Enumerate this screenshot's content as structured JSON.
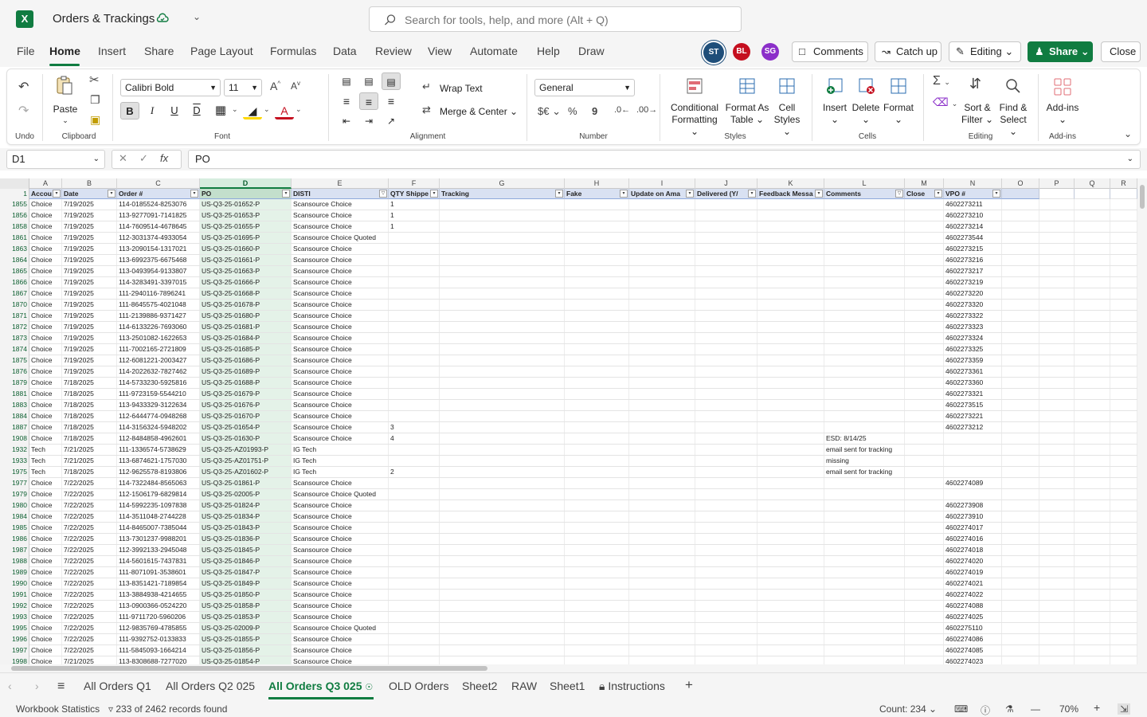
{
  "app": {
    "title": "Orders & Trackings",
    "logo": "X",
    "search_placeholder": "Search for tools, help, and more (Alt + Q)"
  },
  "menu": {
    "tabs": [
      "File",
      "Home",
      "Insert",
      "Share",
      "Page Layout",
      "Formulas",
      "Data",
      "Review",
      "View",
      "Automate",
      "Help",
      "Draw"
    ],
    "active": "Home"
  },
  "collab": {
    "avatars": [
      {
        "initials": "ST",
        "color": "#1f4e79"
      },
      {
        "initials": "BL",
        "color": "#c50f1f"
      },
      {
        "initials": "SG",
        "color": "#8b2fc9"
      }
    ],
    "comments": "Comments",
    "catchup": "Catch up",
    "editing": "Editing",
    "share": "Share",
    "close": "Close"
  },
  "ribbon": {
    "undo_label": "Undo",
    "clipboard_label": "Clipboard",
    "paste": "Paste",
    "font_name": "Calibri Bold",
    "font_size": "11",
    "font_label": "Font",
    "wrap_text": "Wrap Text",
    "merge_center": "Merge & Center",
    "alignment_label": "Alignment",
    "number_format": "General",
    "number_label": "Number",
    "cond_format_1": "Conditional",
    "cond_format_2": "Formatting",
    "format_table_1": "Format As",
    "format_table_2": "Table",
    "cell_styles_1": "Cell",
    "cell_styles_2": "Styles",
    "styles_label": "Styles",
    "insert": "Insert",
    "delete": "Delete",
    "format": "Format",
    "cells_label": "Cells",
    "sort_1": "Sort &",
    "sort_2": "Filter",
    "find_1": "Find &",
    "find_2": "Select",
    "editing_label": "Editing",
    "addins": "Add-ins",
    "addins_label": "Add-ins"
  },
  "formula_bar": {
    "name_box": "D1",
    "content": "PO"
  },
  "columns": {
    "letters": [
      "A",
      "B",
      "C",
      "D",
      "E",
      "F",
      "G",
      "H",
      "I",
      "J",
      "K",
      "L",
      "M",
      "N",
      "O",
      "P",
      "Q",
      "R"
    ],
    "selected": "D"
  },
  "headers": [
    "Accou",
    "Date",
    "Order #",
    "PO",
    "DISTI",
    "QTY Shippe",
    "Tracking",
    "Fake",
    "Update on Ama",
    "Delivered (Y/",
    "Feedback Messa",
    "Comments",
    "Close",
    "VPO #"
  ],
  "rows": [
    [
      "1855",
      "Choice",
      "7/19/2025",
      "114-0185524-8253076",
      "US-Q3-25-01652-P",
      "Scansource Choice",
      "1",
      "",
      "",
      "",
      "",
      "",
      "",
      "",
      "4602273211"
    ],
    [
      "1856",
      "Choice",
      "7/19/2025",
      "113-9277091-7141825",
      "US-Q3-25-01653-P",
      "Scansource Choice",
      "1",
      "",
      "",
      "",
      "",
      "",
      "",
      "",
      "4602273210"
    ],
    [
      "1858",
      "Choice",
      "7/19/2025",
      "114-7609514-4678645",
      "US-Q3-25-01655-P",
      "Scansource Choice",
      "1",
      "",
      "",
      "",
      "",
      "",
      "",
      "",
      "4602273214"
    ],
    [
      "1861",
      "Choice",
      "7/19/2025",
      "112-3031374-4933054",
      "US-Q3-25-01695-P",
      "Scansource Choice Quoted",
      "",
      "",
      "",
      "",
      "",
      "",
      "",
      "",
      "4602273544"
    ],
    [
      "1863",
      "Choice",
      "7/19/2025",
      "113-2090154-1317021",
      "US-Q3-25-01660-P",
      "Scansource Choice",
      "",
      "",
      "",
      "",
      "",
      "",
      "",
      "",
      "4602273215"
    ],
    [
      "1864",
      "Choice",
      "7/19/2025",
      "113-6992375-6675468",
      "US-Q3-25-01661-P",
      "Scansource Choice",
      "",
      "",
      "",
      "",
      "",
      "",
      "",
      "",
      "4602273216"
    ],
    [
      "1865",
      "Choice",
      "7/19/2025",
      "113-0493954-9133807",
      "US-Q3-25-01663-P",
      "Scansource Choice",
      "",
      "",
      "",
      "",
      "",
      "",
      "",
      "",
      "4602273217"
    ],
    [
      "1866",
      "Choice",
      "7/19/2025",
      "114-3283491-3397015",
      "US-Q3-25-01666-P",
      "Scansource Choice",
      "",
      "",
      "",
      "",
      "",
      "",
      "",
      "",
      "4602273219"
    ],
    [
      "1867",
      "Choice",
      "7/19/2025",
      "111-2940116-7896241",
      "US-Q3-25-01668-P",
      "Scansource Choice",
      "",
      "",
      "",
      "",
      "",
      "",
      "",
      "",
      "4602273220"
    ],
    [
      "1870",
      "Choice",
      "7/19/2025",
      "111-8645575-4021048",
      "US-Q3-25-01678-P",
      "Scansource Choice",
      "",
      "",
      "",
      "",
      "",
      "",
      "",
      "",
      "4602273320"
    ],
    [
      "1871",
      "Choice",
      "7/19/2025",
      "111-2139886-9371427",
      "US-Q3-25-01680-P",
      "Scansource Choice",
      "",
      "",
      "",
      "",
      "",
      "",
      "",
      "",
      "4602273322"
    ],
    [
      "1872",
      "Choice",
      "7/19/2025",
      "114-6133226-7693060",
      "US-Q3-25-01681-P",
      "Scansource Choice",
      "",
      "",
      "",
      "",
      "",
      "",
      "",
      "",
      "4602273323"
    ],
    [
      "1873",
      "Choice",
      "7/19/2025",
      "113-2501082-1622653",
      "US-Q3-25-01684-P",
      "Scansource Choice",
      "",
      "",
      "",
      "",
      "",
      "",
      "",
      "",
      "4602273324"
    ],
    [
      "1874",
      "Choice",
      "7/19/2025",
      "111-7002165-2721809",
      "US-Q3-25-01685-P",
      "Scansource Choice",
      "",
      "",
      "",
      "",
      "",
      "",
      "",
      "",
      "4602273325"
    ],
    [
      "1875",
      "Choice",
      "7/19/2025",
      "112-6081221-2003427",
      "US-Q3-25-01686-P",
      "Scansource Choice",
      "",
      "",
      "",
      "",
      "",
      "",
      "",
      "",
      "4602273359"
    ],
    [
      "1876",
      "Choice",
      "7/19/2025",
      "114-2022632-7827462",
      "US-Q3-25-01689-P",
      "Scansource Choice",
      "",
      "",
      "",
      "",
      "",
      "",
      "",
      "",
      "4602273361"
    ],
    [
      "1879",
      "Choice",
      "7/18/2025",
      "114-5733230-5925816",
      "US-Q3-25-01688-P",
      "Scansource Choice",
      "",
      "",
      "",
      "",
      "",
      "",
      "",
      "",
      "4602273360"
    ],
    [
      "1881",
      "Choice",
      "7/18/2025",
      "111-9723159-5544210",
      "US-Q3-25-01679-P",
      "Scansource Choice",
      "",
      "",
      "",
      "",
      "",
      "",
      "",
      "",
      "4602273321"
    ],
    [
      "1883",
      "Choice",
      "7/18/2025",
      "113-9433329-3122634",
      "US-Q3-25-01676-P",
      "Scansource Choice",
      "",
      "",
      "",
      "",
      "",
      "",
      "",
      "",
      "4602273515"
    ],
    [
      "1884",
      "Choice",
      "7/18/2025",
      "112-6444774-0948268",
      "US-Q3-25-01670-P",
      "Scansource Choice",
      "",
      "",
      "",
      "",
      "",
      "",
      "",
      "",
      "4602273221"
    ],
    [
      "1887",
      "Choice",
      "7/18/2025",
      "114-3156324-5948202",
      "US-Q3-25-01654-P",
      "Scansource Choice",
      "3",
      "",
      "",
      "",
      "",
      "",
      "",
      "",
      "4602273212"
    ],
    [
      "1908",
      "Choice",
      "7/18/2025",
      "112-8484858-4962601",
      "US-Q3-25-01630-P",
      "Scansource Choice",
      "4",
      "",
      "",
      "",
      "",
      "",
      "ESD: 8/14/25",
      "",
      ""
    ],
    [
      "1932",
      "Tech",
      "7/21/2025",
      "111-1336574-5738629",
      "US-Q3-25-AZ01993-P",
      "IG Tech",
      "",
      "",
      "",
      "",
      "",
      "",
      "email sent for tracking",
      "",
      ""
    ],
    [
      "1933",
      "Tech",
      "7/21/2025",
      "113-6874621-1757030",
      "US-Q3-25-AZ01751-P",
      "IG Tech",
      "",
      "",
      "",
      "",
      "",
      "",
      "missing",
      "",
      ""
    ],
    [
      "1975",
      "Tech",
      "7/18/2025",
      "112-9625578-8193806",
      "US-Q3-25-AZ01602-P",
      "IG Tech",
      "2",
      "",
      "",
      "",
      "",
      "",
      "email sent for tracking",
      "",
      ""
    ],
    [
      "1977",
      "Choice",
      "7/22/2025",
      "114-7322484-8565063",
      "US-Q3-25-01861-P",
      "Scansource Choice",
      "",
      "",
      "",
      "",
      "",
      "",
      "",
      "",
      "4602274089"
    ],
    [
      "1979",
      "Choice",
      "7/22/2025",
      "112-1506179-6829814",
      "US-Q3-25-02005-P",
      "Scansource Choice Quoted",
      "",
      "",
      "",
      "",
      "",
      "",
      "",
      "",
      ""
    ],
    [
      "1980",
      "Choice",
      "7/22/2025",
      "114-5992235-1097838",
      "US-Q3-25-01824-P",
      "Scansource Choice",
      "",
      "",
      "",
      "",
      "",
      "",
      "",
      "",
      "4602273908"
    ],
    [
      "1984",
      "Choice",
      "7/22/2025",
      "114-3511048-2744228",
      "US-Q3-25-01834-P",
      "Scansource Choice",
      "",
      "",
      "",
      "",
      "",
      "",
      "",
      "",
      "4602273910"
    ],
    [
      "1985",
      "Choice",
      "7/22/2025",
      "114-8465007-7385044",
      "US-Q3-25-01843-P",
      "Scansource Choice",
      "",
      "",
      "",
      "",
      "",
      "",
      "",
      "",
      "4602274017"
    ],
    [
      "1986",
      "Choice",
      "7/22/2025",
      "113-7301237-9988201",
      "US-Q3-25-01836-P",
      "Scansource Choice",
      "",
      "",
      "",
      "",
      "",
      "",
      "",
      "",
      "4602274016"
    ],
    [
      "1987",
      "Choice",
      "7/22/2025",
      "112-3992133-2945048",
      "US-Q3-25-01845-P",
      "Scansource Choice",
      "",
      "",
      "",
      "",
      "",
      "",
      "",
      "",
      "4602274018"
    ],
    [
      "1988",
      "Choice",
      "7/22/2025",
      "114-5601615-7437831",
      "US-Q3-25-01846-P",
      "Scansource Choice",
      "",
      "",
      "",
      "",
      "",
      "",
      "",
      "",
      "4602274020"
    ],
    [
      "1989",
      "Choice",
      "7/22/2025",
      "111-8071091-3538601",
      "US-Q3-25-01847-P",
      "Scansource Choice",
      "",
      "",
      "",
      "",
      "",
      "",
      "",
      "",
      "4602274019"
    ],
    [
      "1990",
      "Choice",
      "7/22/2025",
      "113-8351421-7189854",
      "US-Q3-25-01849-P",
      "Scansource Choice",
      "",
      "",
      "",
      "",
      "",
      "",
      "",
      "",
      "4602274021"
    ],
    [
      "1991",
      "Choice",
      "7/22/2025",
      "113-3884938-4214655",
      "US-Q3-25-01850-P",
      "Scansource Choice",
      "",
      "",
      "",
      "",
      "",
      "",
      "",
      "",
      "4602274022"
    ],
    [
      "1992",
      "Choice",
      "7/22/2025",
      "113-0900366-0524220",
      "US-Q3-25-01858-P",
      "Scansource Choice",
      "",
      "",
      "",
      "",
      "",
      "",
      "",
      "",
      "4602274088"
    ],
    [
      "1993",
      "Choice",
      "7/22/2025",
      "111-9711720-5960206",
      "US-Q3-25-01853-P",
      "Scansource Choice",
      "",
      "",
      "",
      "",
      "",
      "",
      "",
      "",
      "4602274025"
    ],
    [
      "1995",
      "Choice",
      "7/22/2025",
      "112-9835769-4785855",
      "US-Q3-25-02009-P",
      "Scansource Choice Quoted",
      "",
      "",
      "",
      "",
      "",
      "",
      "",
      "",
      "4602275110"
    ],
    [
      "1996",
      "Choice",
      "7/22/2025",
      "111-9392752-0133833",
      "US-Q3-25-01855-P",
      "Scansource Choice",
      "",
      "",
      "",
      "",
      "",
      "",
      "",
      "",
      "4602274086"
    ],
    [
      "1997",
      "Choice",
      "7/22/2025",
      "111-5845093-1664214",
      "US-Q3-25-01856-P",
      "Scansource Choice",
      "",
      "",
      "",
      "",
      "",
      "",
      "",
      "",
      "4602274085"
    ],
    [
      "1998",
      "Choice",
      "7/21/2025",
      "113-8308688-7277020",
      "US-Q3-25-01854-P",
      "Scansource Choice",
      "",
      "",
      "",
      "",
      "",
      "",
      "",
      "",
      "4602274023"
    ]
  ],
  "sheets": {
    "tabs": [
      "All Orders Q1",
      "All Orders Q2 025",
      "All Orders Q3 025",
      "OLD Orders",
      "Sheet2",
      "RAW",
      "Sheet1",
      "Instructions"
    ],
    "active": "All Orders Q3 025"
  },
  "status": {
    "stats": "Workbook Statistics",
    "records": "233 of 2462 records found",
    "count": "Count: 234",
    "zoom": "70%"
  }
}
